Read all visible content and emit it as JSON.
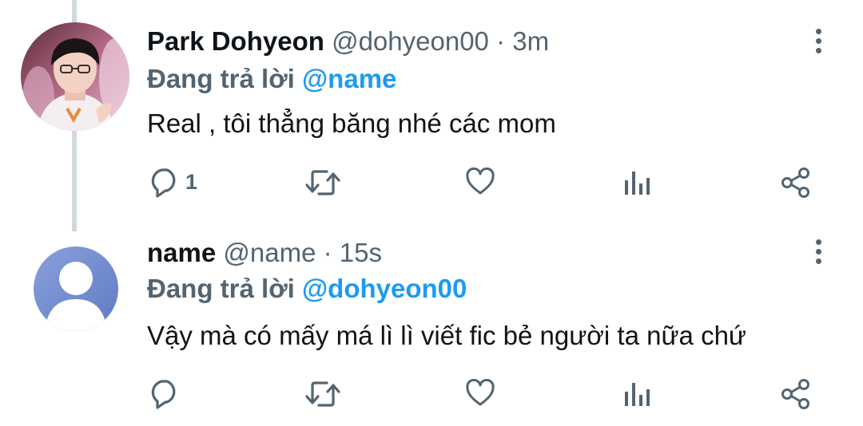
{
  "tweets": [
    {
      "display_name": "Park Dohyeon",
      "handle": "@dohyeon00",
      "separator": "·",
      "time": "3m",
      "reply_prefix": "Đang trả lời",
      "reply_to": "@name",
      "text": "Real , tôi thẳng băng nhé các mom",
      "reply_count": "1"
    },
    {
      "display_name": "name",
      "handle": "@name",
      "separator": "·",
      "time": "15s",
      "reply_prefix": "Đang trả lời",
      "reply_to": "@dohyeon00",
      "text": "Vậy mà có mấy má lì lì viết fic bẻ người ta nữa chứ",
      "reply_count": ""
    }
  ],
  "icons": {
    "reply": "reply-icon",
    "retweet": "retweet-icon",
    "like": "heart-icon",
    "analytics": "analytics-icon",
    "share": "share-icon",
    "more": "more-vertical-icon"
  },
  "colors": {
    "mention": "#1d9bf0",
    "muted": "#536471",
    "thread_line": "#cfd9de",
    "avatar_default": "#6f8ccf"
  }
}
